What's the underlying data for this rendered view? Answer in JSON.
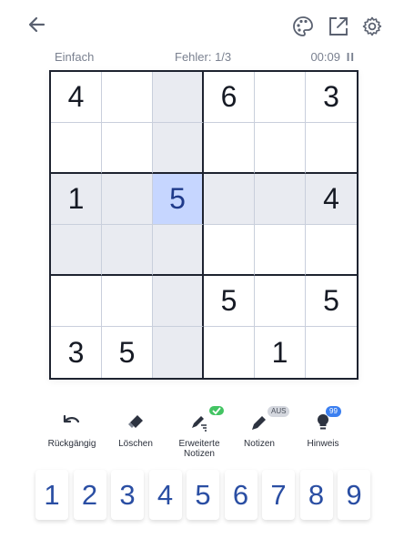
{
  "header": {
    "back_icon": "arrow-left-icon",
    "theme_icon": "palette-icon",
    "share_icon": "export-icon",
    "settings_icon": "gear-icon"
  },
  "status": {
    "difficulty": "Einfach",
    "errors": "Fehler: 1/3",
    "timer": "00:09",
    "pause_symbol": "II"
  },
  "board": {
    "rows": [
      [
        "4",
        "",
        "",
        "6",
        "",
        "3"
      ],
      [
        "",
        "",
        "",
        "",
        "",
        ""
      ],
      [
        "1",
        "",
        "5",
        "",
        "",
        "4"
      ],
      [
        "",
        "",
        "",
        "",
        "",
        ""
      ],
      [
        "",
        "",
        "",
        "5",
        "",
        "5"
      ],
      [
        "3",
        "5",
        "",
        "",
        "1",
        ""
      ]
    ],
    "selected": "r2c2",
    "highlight_color": "#e9ebf1",
    "selected_color": "#c6d6ff"
  },
  "toolbar": {
    "undo": "Rückgängig",
    "erase": "Löschen",
    "adv_notes": "Erweiterte Notizen",
    "adv_badge_icon": "check-icon",
    "notes": "Notizen",
    "notes_badge": "AUS",
    "hint": "Hinweis",
    "hint_badge": "99"
  },
  "numpad": {
    "keys": [
      "1",
      "2",
      "3",
      "4",
      "5",
      "6",
      "7",
      "8",
      "9"
    ],
    "color": "#2a4ea3"
  }
}
